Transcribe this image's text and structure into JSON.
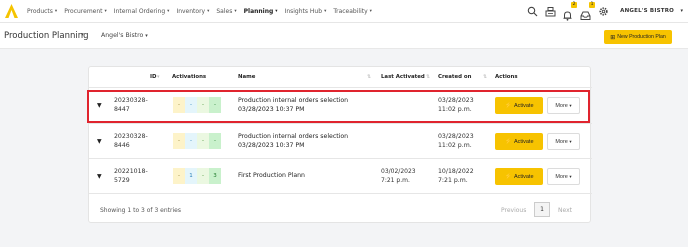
{
  "nav": {
    "items": [
      {
        "label": "Products",
        "active": false
      },
      {
        "label": "Procurement",
        "active": false
      },
      {
        "label": "Internal Ordering",
        "active": false
      },
      {
        "label": "Inventory",
        "active": false
      },
      {
        "label": "Sales",
        "active": false
      },
      {
        "label": "Planning",
        "active": true
      },
      {
        "label": "Insights Hub",
        "active": false
      },
      {
        "label": "Traceability",
        "active": false
      }
    ],
    "notification_count": "2",
    "tray_count": "1",
    "user_name": "ANGEL'S BISTRO"
  },
  "header": {
    "title": "Production Planning",
    "location": "Angel's Bistro",
    "new_plan_label": "New Production Plan"
  },
  "table": {
    "columns": {
      "id": "ID",
      "activations": "Activations",
      "name": "Name",
      "last_activated": "Last Activated",
      "created_on": "Created on",
      "actions": "Actions"
    },
    "rows": [
      {
        "id_line1": "20230328-",
        "id_line2": "8447",
        "activations": [
          "-",
          "-",
          "-",
          "-"
        ],
        "name_line1": "Production internal orders selection",
        "name_line2": "03/28/2023 10:37 PM",
        "last_activated_line1": "",
        "last_activated_line2": "",
        "created_line1": "03/28/2023",
        "created_line2": "11:02 p.m.",
        "activate_label": "Activate",
        "more_label": "More"
      },
      {
        "id_line1": "20230328-",
        "id_line2": "8446",
        "activations": [
          "-",
          "-",
          "-",
          "-"
        ],
        "name_line1": "Production internal orders selection",
        "name_line2": "03/28/2023 10:37 PM",
        "last_activated_line1": "",
        "last_activated_line2": "",
        "created_line1": "03/28/2023",
        "created_line2": "11:02 p.m.",
        "activate_label": "Activate",
        "more_label": "More"
      },
      {
        "id_line1": "20221018-",
        "id_line2": "5729",
        "activations": [
          "-",
          "1",
          "-",
          "3"
        ],
        "name_line1": "First Production Plann",
        "name_line2": "",
        "last_activated_line1": "03/02/2023",
        "last_activated_line2": "7:21 p.m.",
        "created_line1": "10/18/2022",
        "created_line2": "7:21 p.m.",
        "activate_label": "Activate",
        "more_label": "More"
      }
    ],
    "footer": {
      "summary": "Showing 1 to 3 of 3 entries",
      "previous": "Previous",
      "page": "1",
      "next": "Next"
    }
  },
  "colors": {
    "accent": "#f7c300",
    "highlight": "#e0242e"
  }
}
